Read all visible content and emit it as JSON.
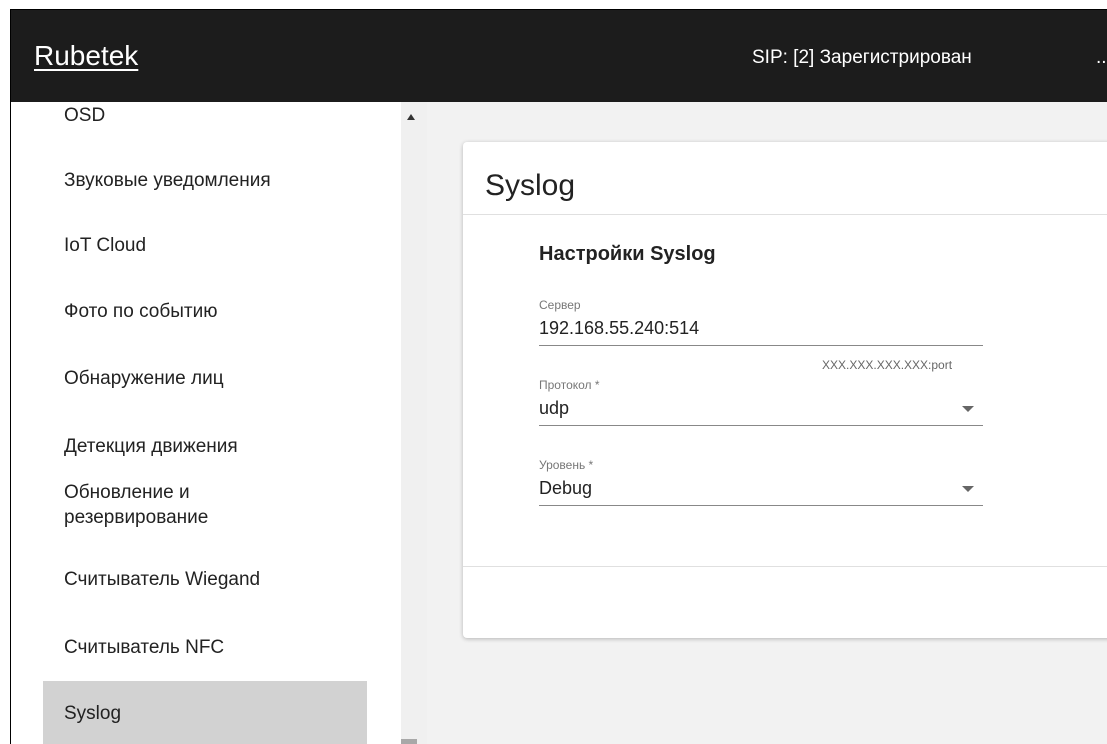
{
  "header": {
    "brand": "Rubetek",
    "sip_status": "SIP: [2] Зарегистрирован",
    "more": ".."
  },
  "sidebar": {
    "items": [
      {
        "label": "OSD"
      },
      {
        "label": "Звуковые уведомления"
      },
      {
        "label": "IoT Cloud"
      },
      {
        "label": "Фото по событию"
      },
      {
        "label": "Обнаружение лиц"
      },
      {
        "label": "Детекция движения"
      },
      {
        "label": "Обновление и"
      },
      {
        "label": "резервирование"
      },
      {
        "label": "Считыватель Wiegand"
      },
      {
        "label": "Считыватель NFC"
      },
      {
        "label": "Syslog",
        "active": true
      }
    ]
  },
  "card": {
    "title": "Syslog",
    "section_title": "Настройки Syslog",
    "server": {
      "label": "Сервер",
      "value": "192.168.55.240:514",
      "hint": "XXX.XXX.XXX.XXX:port"
    },
    "protocol": {
      "label": "Протокол *",
      "value": "udp"
    },
    "level": {
      "label": "Уровень *",
      "value": "Debug"
    }
  },
  "icons": {
    "scroll_up": "chevron-up-icon",
    "dropdown": "dropdown-arrow-icon"
  }
}
